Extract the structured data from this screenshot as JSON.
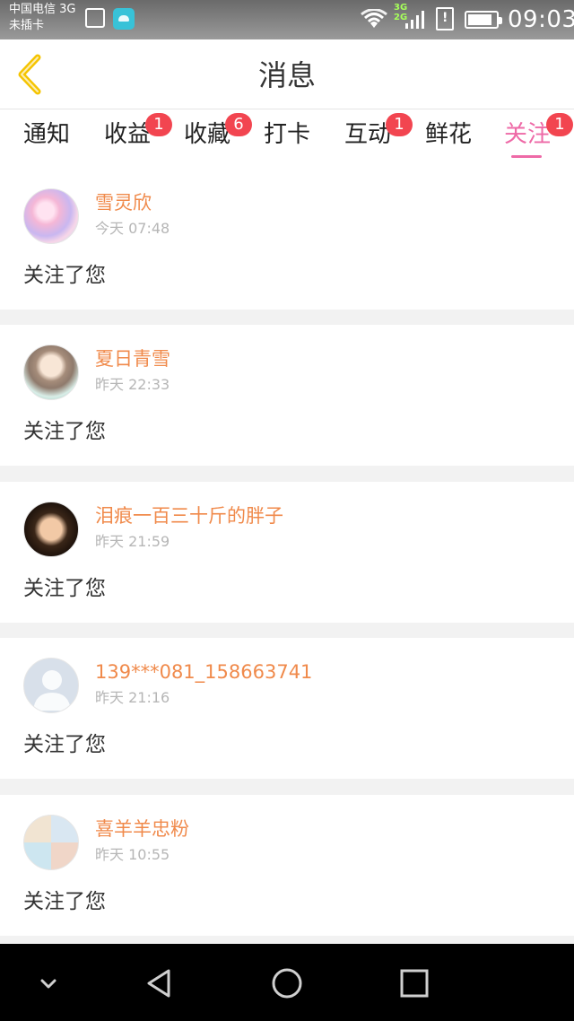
{
  "status_bar": {
    "carrier_line1": "中国电信 3G",
    "carrier_line2": "未插卡",
    "network_label": "3G\n2G",
    "time": "09:03"
  },
  "header": {
    "title": "消息",
    "back_icon": "chevron-left-icon",
    "accent_color": "#f5c400"
  },
  "tabs": [
    {
      "label": "通知",
      "badge": ""
    },
    {
      "label": "收益",
      "badge": "1"
    },
    {
      "label": "收藏",
      "badge": "6"
    },
    {
      "label": "打卡",
      "badge": ""
    },
    {
      "label": "互动",
      "badge": "1"
    },
    {
      "label": "鲜花",
      "badge": ""
    },
    {
      "label": "关注",
      "badge": "1",
      "active": true
    }
  ],
  "colors": {
    "active_tab": "#ee6aa7",
    "badge": "#f24550",
    "username": "#f08a4b",
    "time": "#b6b6b6"
  },
  "notifications": [
    {
      "username": "雪灵欣",
      "time": "今天 07:48",
      "message": "关注了您"
    },
    {
      "username": "夏日青雪",
      "time": "昨天 22:33",
      "message": "关注了您"
    },
    {
      "username": "泪痕一百三十斤的胖子",
      "time": "昨天 21:59",
      "message": "关注了您"
    },
    {
      "username": "139***081_158663741",
      "time": "昨天 21:16",
      "message": "关注了您"
    },
    {
      "username": "喜羊羊忠粉",
      "time": "昨天 10:55",
      "message": "关注了您"
    }
  ],
  "nav": {
    "icons": [
      "chevron-down-icon",
      "back-triangle-icon",
      "home-circle-icon",
      "recents-square-icon"
    ]
  }
}
